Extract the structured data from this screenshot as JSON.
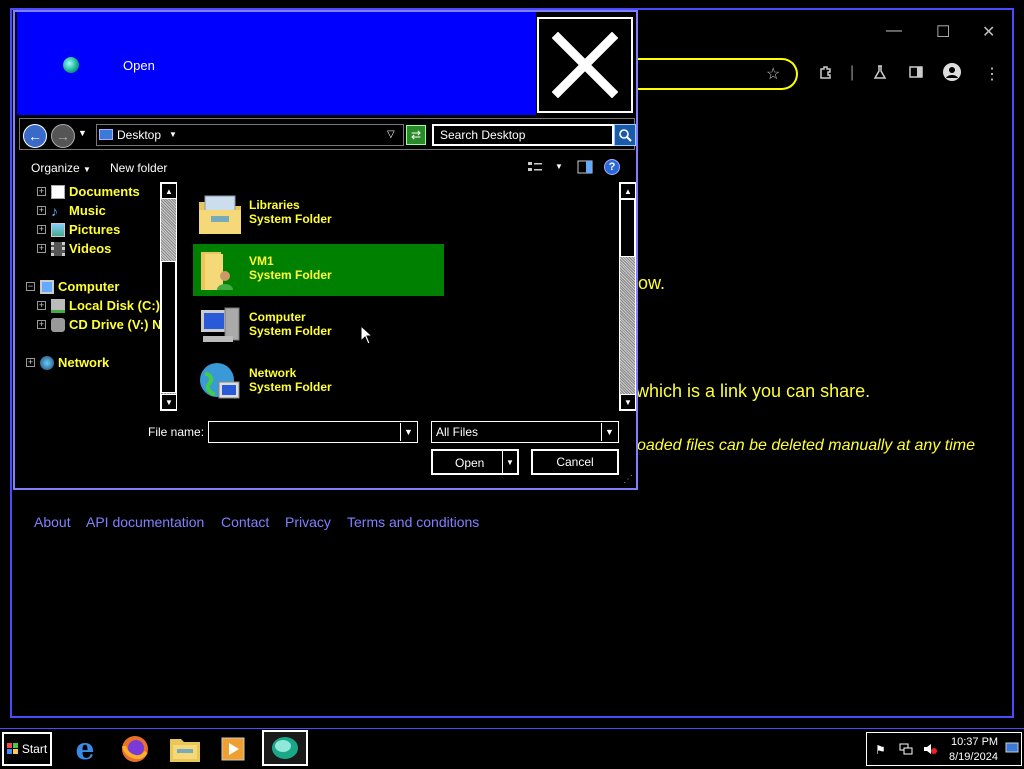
{
  "browser": {
    "window_controls": {
      "minimize": "—",
      "maximize": "☐",
      "close": "✕"
    },
    "page_text": {
      "line1": "ow.",
      "line2": "which is a link you can share.",
      "line3": "oaded files can be deleted manually at any time"
    },
    "footer_links": [
      "About",
      "API documentation",
      "Contact",
      "Privacy",
      "Terms and conditions"
    ]
  },
  "dialog": {
    "title": "Open",
    "address": "Desktop",
    "search_placeholder": "Search Desktop",
    "commands": {
      "organize": "Organize",
      "new_folder": "New folder"
    },
    "tree": [
      {
        "label": "Documents",
        "icon": "documents-icon"
      },
      {
        "label": "Music",
        "icon": "music-icon"
      },
      {
        "label": "Pictures",
        "icon": "pictures-icon"
      },
      {
        "label": "Videos",
        "icon": "videos-icon"
      },
      {
        "label": "Computer",
        "icon": "computer-icon"
      },
      {
        "label": "Local Disk (C:)",
        "icon": "disk-icon"
      },
      {
        "label": "CD Drive (V:) N",
        "icon": "cd-drive-icon"
      },
      {
        "label": "Network",
        "icon": "network-icon"
      }
    ],
    "files": [
      {
        "name": "Libraries",
        "type": "System Folder",
        "icon": "libraries-folder-icon",
        "selected": false
      },
      {
        "name": "VM1",
        "type": "System Folder",
        "icon": "user-folder-icon",
        "selected": true
      },
      {
        "name": "Computer",
        "type": "System Folder",
        "icon": "computer-icon",
        "selected": false
      },
      {
        "name": "Network",
        "type": "System Folder",
        "icon": "network-globe-icon",
        "selected": false
      }
    ],
    "file_name_label": "File name:",
    "file_name_value": "",
    "file_type": "All Files",
    "open_button": "Open",
    "cancel_button": "Cancel"
  },
  "taskbar": {
    "start_label": "Start",
    "apps": [
      "internet-explorer-icon",
      "firefox-icon",
      "file-explorer-icon",
      "media-player-icon",
      "app-globe-icon"
    ],
    "clock_time": "10:37 PM",
    "clock_date": "8/19/2024"
  },
  "colors": {
    "title_bar": "#0000ff",
    "text_yellow": "#ffff33",
    "selection_green": "#008000",
    "link_blue": "#8080ff"
  }
}
